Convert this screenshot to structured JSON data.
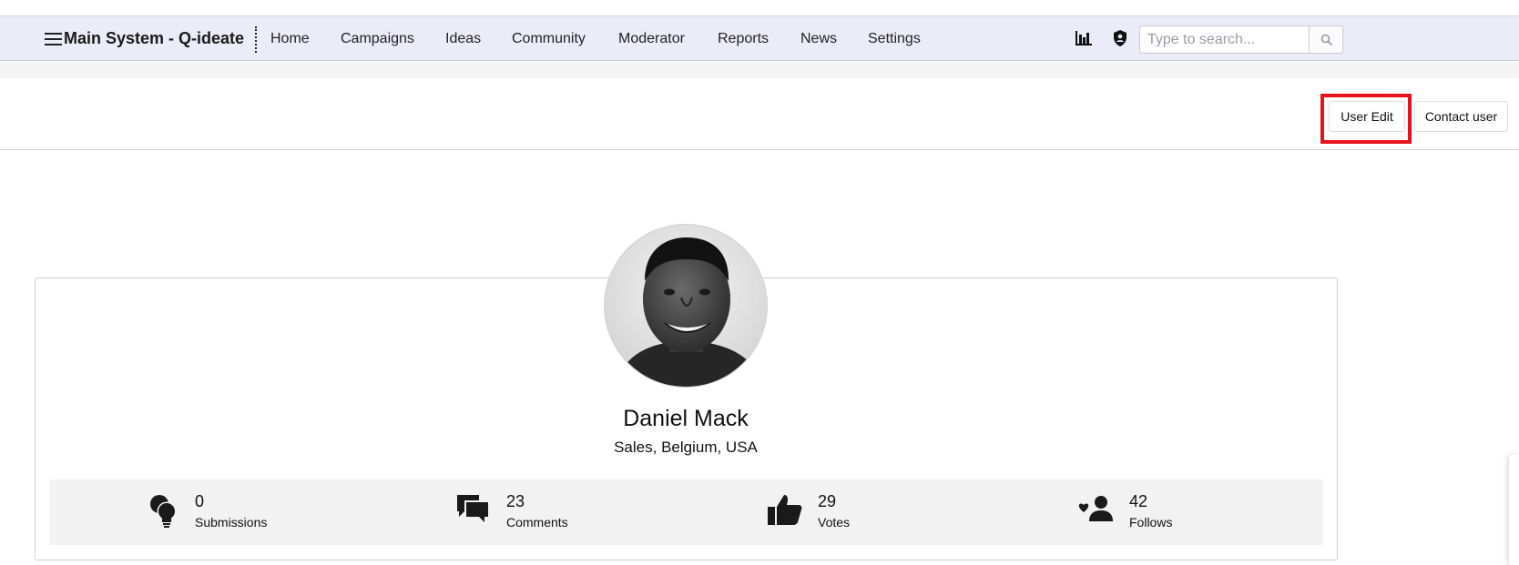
{
  "header": {
    "brand": "Main System - Q-ideate",
    "nav": [
      "Home",
      "Campaigns",
      "Ideas",
      "Community",
      "Moderator",
      "Reports",
      "News",
      "Settings"
    ],
    "icons": [
      "bar-chart-icon",
      "shield-user-icon",
      "search-icon"
    ],
    "search_placeholder": "Type to search..."
  },
  "toolbar": {
    "user_edit_label": "User Edit",
    "contact_user_label": "Contact user",
    "highlight_color": "#e8121b"
  },
  "profile": {
    "name": "Daniel Mack",
    "subtitle": "Sales, Belgium, USA"
  },
  "stats": [
    {
      "icon": "lightbulb-icon",
      "value": "0",
      "label": "Submissions"
    },
    {
      "icon": "comments-icon",
      "value": "23",
      "label": "Comments"
    },
    {
      "icon": "thumbs-up-icon",
      "value": "29",
      "label": "Votes"
    },
    {
      "icon": "follow-user-icon",
      "value": "42",
      "label": "Follows"
    }
  ],
  "colors": {
    "navbar_bg": "#ecebf8",
    "stats_bg": "#f2f2f2"
  }
}
